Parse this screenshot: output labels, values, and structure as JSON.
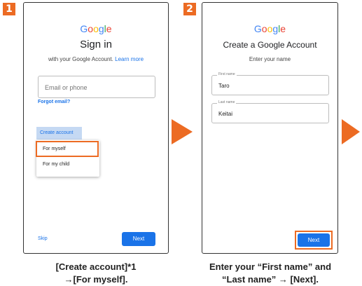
{
  "colors": {
    "accent": "#ec6b23",
    "button_blue": "#1a73e8"
  },
  "steps": [
    {
      "number": "1",
      "logo": {
        "G": "G",
        "o1": "o",
        "o2": "o",
        "g": "g",
        "l": "l",
        "e": "e"
      },
      "title": "Sign in",
      "subtitle_prefix": "with your Google Account.",
      "subtitle_link": "Learn more",
      "email_placeholder": "Email or phone",
      "forgot_email": "Forgot email?",
      "create_account_label": "Create account",
      "menu_items": [
        "For myself",
        "For my child"
      ],
      "skip_label": "Skip",
      "next_label": "Next",
      "caption_line1": "[Create account]*1",
      "caption_line2": "→[For myself]."
    },
    {
      "number": "2",
      "title": "Create a Google Account",
      "subtitle": "Enter your name",
      "first_name_label": "First name",
      "first_name_value": "Taro",
      "last_name_label": "Last name",
      "last_name_value": "Keitai",
      "next_label": "Next",
      "caption_line1": "Enter your “First name” and",
      "caption_line2": "“Last name” → [Next]."
    }
  ]
}
